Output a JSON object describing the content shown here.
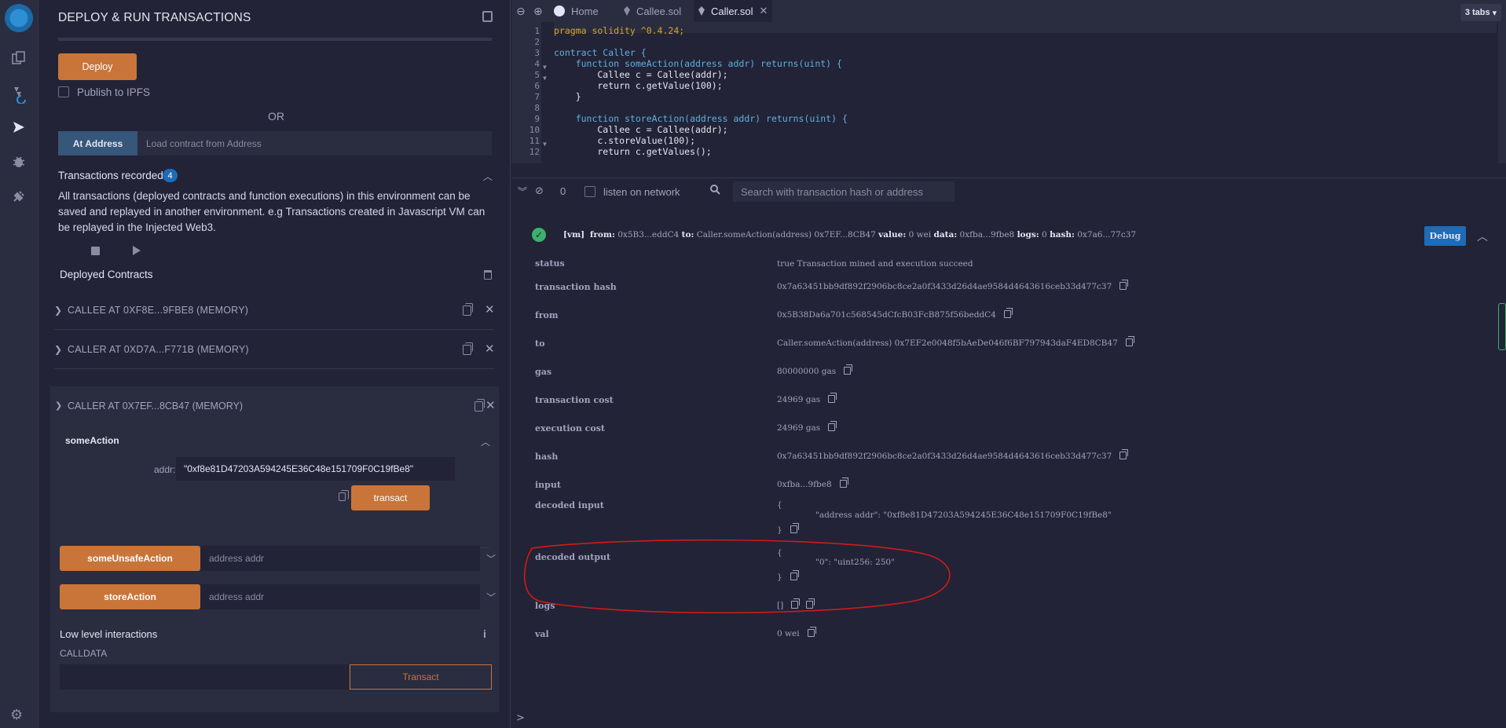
{
  "panel": {
    "title": "DEPLOY & RUN TRANSACTIONS",
    "deploy_label": "Deploy",
    "publish_label": "Publish to IPFS",
    "or_label": "OR",
    "at_address_label": "At Address",
    "load_placeholder": "Load contract from Address",
    "tx_recorded_label": "Transactions recorded",
    "tx_recorded_count": "4",
    "tx_desc": "All transactions (deployed contracts and function executions) in this environment can be saved and replayed in another environment. e.g Transactions created in Javascript VM can be replayed in the Injected Web3.",
    "deployed_label": "Deployed Contracts",
    "contracts": [
      {
        "name": "CALLEE AT 0XF8E...9FBE8 (MEMORY)"
      },
      {
        "name": "CALLER AT 0XD7A...F771B (MEMORY)"
      },
      {
        "name": "CALLER AT 0X7EF...8CB47 (MEMORY)"
      }
    ],
    "some_action": {
      "name": "someAction",
      "addr_label": "addr:",
      "addr_value": "\"0xf8e81D47203A594245E36C48e151709F0C19fBe8\"",
      "transact_label": "transact"
    },
    "functions": [
      {
        "name": "someUnsafeAction",
        "placeholder": "address addr"
      },
      {
        "name": "storeAction",
        "placeholder": "address addr"
      }
    ],
    "low_level_label": "Low level interactions",
    "info_icon": "i",
    "calldata_label": "CALLDATA",
    "transact2_label": "Transact"
  },
  "tabs": {
    "home": "Home",
    "callee": "Callee.sol",
    "caller": "Caller.sol",
    "count": "3 tabs"
  },
  "editor": {
    "lines": [
      {
        "n": "1",
        "text": "pragma solidity ^0.4.24;"
      },
      {
        "n": "2",
        "text": ""
      },
      {
        "n": "3",
        "text": "contract Caller {"
      },
      {
        "n": "4",
        "text": "    function someAction(address addr) returns(uint) {"
      },
      {
        "n": "5",
        "text": "        Callee c = Callee(addr);"
      },
      {
        "n": "6",
        "text": "        return c.getValue(100);"
      },
      {
        "n": "7",
        "text": "    }"
      },
      {
        "n": "8",
        "text": ""
      },
      {
        "n": "9",
        "text": "    function storeAction(address addr) returns(uint) {"
      },
      {
        "n": "10",
        "text": "        Callee c = Callee(addr);"
      },
      {
        "n": "11",
        "text": "        c.storeValue(100);"
      },
      {
        "n": "12",
        "text": "        return c.getValues();"
      }
    ]
  },
  "terminal_bar": {
    "count": "0",
    "listen_label": "listen on network",
    "search_placeholder": "Search with transaction hash or address"
  },
  "tx": {
    "summary_vm": "[vm]",
    "summary_from_k": "from:",
    "summary_from_v": "0x5B3...eddC4",
    "summary_to_k": "to:",
    "summary_to_v": "Caller.someAction(address) 0x7EF...8CB47",
    "summary_value_k": "value:",
    "summary_value_v": "0 wei",
    "summary_data_k": "data:",
    "summary_data_v": "0xfba...9fbe8",
    "summary_logs_k": "logs:",
    "summary_logs_v": "0",
    "summary_hash_k": "hash:",
    "summary_hash_v": "0x7a6...77c37",
    "debug_label": "Debug",
    "rows": [
      {
        "k": "status",
        "v": "true Transaction mined and execution succeed"
      },
      {
        "k": "transaction hash",
        "v": "0x7a63451bb9df892f2906bc8ce2a0f3433d26d4ae9584d4643616ceb33d477c37"
      },
      {
        "k": "from",
        "v": "0x5B38Da6a701c568545dCfcB03FcB875f56beddC4"
      },
      {
        "k": "to",
        "v": "Caller.someAction(address) 0x7EF2e0048f5bAeDe046f6BF797943daF4ED8CB47"
      },
      {
        "k": "gas",
        "v": "80000000 gas"
      },
      {
        "k": "transaction cost",
        "v": "24969 gas"
      },
      {
        "k": "execution cost",
        "v": "24969 gas"
      },
      {
        "k": "hash",
        "v": "0x7a63451bb9df892f2906bc8ce2a0f3433d26d4ae9584d4643616ceb33d477c37"
      },
      {
        "k": "input",
        "v": "0xfba...9fbe8"
      }
    ],
    "decoded_input_k": "decoded input",
    "decoded_input_open": "{",
    "decoded_input_body": "\"address addr\": \"0xf8e81D47203A594245E36C48e151709F0C19fBe8\"",
    "decoded_input_close": "}",
    "decoded_output_k": "decoded output",
    "decoded_output_open": "{",
    "decoded_output_body": "\"0\": \"uint256: 250\"",
    "decoded_output_close": "}",
    "logs_k": "logs",
    "logs_v": "[]",
    "val_k": "val",
    "val_v": "0 wei",
    "prompt": ">"
  },
  "colors": {
    "accent_orange": "#c97539",
    "accent_blue": "#1e6bb8",
    "success_green": "#3bb16e",
    "annotation_red": "#d01a1a"
  }
}
